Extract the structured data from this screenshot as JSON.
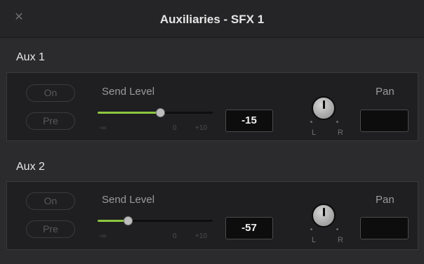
{
  "window": {
    "title": "Auxiliaries - SFX 1",
    "close_icon": "close-icon"
  },
  "aux": [
    {
      "label": "Aux 1",
      "on_label": "On",
      "pre_label": "Pre",
      "send_label": "Send Level",
      "scale_min": "-∞",
      "scale_zero": "0",
      "scale_max": "+10",
      "send_value": "-15",
      "pan_label": "Pan",
      "pan_left": "L",
      "pan_right": "R",
      "pan_value": ""
    },
    {
      "label": "Aux 2",
      "on_label": "On",
      "pre_label": "Pre",
      "send_label": "Send Level",
      "scale_min": "-∞",
      "scale_zero": "0",
      "scale_max": "+10",
      "send_value": "-57",
      "pan_label": "Pan",
      "pan_left": "L",
      "pan_right": "R",
      "pan_value": ""
    }
  ],
  "colors": {
    "accent_green": "#8dc63f",
    "background": "#2b2b2d",
    "panel": "#1f1f21"
  }
}
